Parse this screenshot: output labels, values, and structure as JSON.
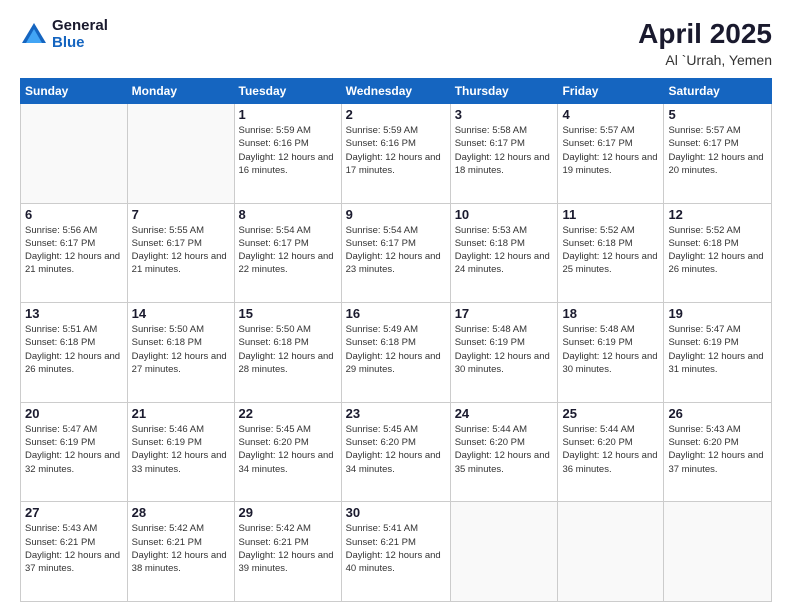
{
  "logo": {
    "general": "General",
    "blue": "Blue"
  },
  "header": {
    "month": "April 2025",
    "location": "Al `Urrah, Yemen"
  },
  "weekdays": [
    "Sunday",
    "Monday",
    "Tuesday",
    "Wednesday",
    "Thursday",
    "Friday",
    "Saturday"
  ],
  "weeks": [
    [
      {
        "day": "",
        "info": ""
      },
      {
        "day": "",
        "info": ""
      },
      {
        "day": "1",
        "info": "Sunrise: 5:59 AM\nSunset: 6:16 PM\nDaylight: 12 hours and 16 minutes."
      },
      {
        "day": "2",
        "info": "Sunrise: 5:59 AM\nSunset: 6:16 PM\nDaylight: 12 hours and 17 minutes."
      },
      {
        "day": "3",
        "info": "Sunrise: 5:58 AM\nSunset: 6:17 PM\nDaylight: 12 hours and 18 minutes."
      },
      {
        "day": "4",
        "info": "Sunrise: 5:57 AM\nSunset: 6:17 PM\nDaylight: 12 hours and 19 minutes."
      },
      {
        "day": "5",
        "info": "Sunrise: 5:57 AM\nSunset: 6:17 PM\nDaylight: 12 hours and 20 minutes."
      }
    ],
    [
      {
        "day": "6",
        "info": "Sunrise: 5:56 AM\nSunset: 6:17 PM\nDaylight: 12 hours and 21 minutes."
      },
      {
        "day": "7",
        "info": "Sunrise: 5:55 AM\nSunset: 6:17 PM\nDaylight: 12 hours and 21 minutes."
      },
      {
        "day": "8",
        "info": "Sunrise: 5:54 AM\nSunset: 6:17 PM\nDaylight: 12 hours and 22 minutes."
      },
      {
        "day": "9",
        "info": "Sunrise: 5:54 AM\nSunset: 6:17 PM\nDaylight: 12 hours and 23 minutes."
      },
      {
        "day": "10",
        "info": "Sunrise: 5:53 AM\nSunset: 6:18 PM\nDaylight: 12 hours and 24 minutes."
      },
      {
        "day": "11",
        "info": "Sunrise: 5:52 AM\nSunset: 6:18 PM\nDaylight: 12 hours and 25 minutes."
      },
      {
        "day": "12",
        "info": "Sunrise: 5:52 AM\nSunset: 6:18 PM\nDaylight: 12 hours and 26 minutes."
      }
    ],
    [
      {
        "day": "13",
        "info": "Sunrise: 5:51 AM\nSunset: 6:18 PM\nDaylight: 12 hours and 26 minutes."
      },
      {
        "day": "14",
        "info": "Sunrise: 5:50 AM\nSunset: 6:18 PM\nDaylight: 12 hours and 27 minutes."
      },
      {
        "day": "15",
        "info": "Sunrise: 5:50 AM\nSunset: 6:18 PM\nDaylight: 12 hours and 28 minutes."
      },
      {
        "day": "16",
        "info": "Sunrise: 5:49 AM\nSunset: 6:18 PM\nDaylight: 12 hours and 29 minutes."
      },
      {
        "day": "17",
        "info": "Sunrise: 5:48 AM\nSunset: 6:19 PM\nDaylight: 12 hours and 30 minutes."
      },
      {
        "day": "18",
        "info": "Sunrise: 5:48 AM\nSunset: 6:19 PM\nDaylight: 12 hours and 30 minutes."
      },
      {
        "day": "19",
        "info": "Sunrise: 5:47 AM\nSunset: 6:19 PM\nDaylight: 12 hours and 31 minutes."
      }
    ],
    [
      {
        "day": "20",
        "info": "Sunrise: 5:47 AM\nSunset: 6:19 PM\nDaylight: 12 hours and 32 minutes."
      },
      {
        "day": "21",
        "info": "Sunrise: 5:46 AM\nSunset: 6:19 PM\nDaylight: 12 hours and 33 minutes."
      },
      {
        "day": "22",
        "info": "Sunrise: 5:45 AM\nSunset: 6:20 PM\nDaylight: 12 hours and 34 minutes."
      },
      {
        "day": "23",
        "info": "Sunrise: 5:45 AM\nSunset: 6:20 PM\nDaylight: 12 hours and 34 minutes."
      },
      {
        "day": "24",
        "info": "Sunrise: 5:44 AM\nSunset: 6:20 PM\nDaylight: 12 hours and 35 minutes."
      },
      {
        "day": "25",
        "info": "Sunrise: 5:44 AM\nSunset: 6:20 PM\nDaylight: 12 hours and 36 minutes."
      },
      {
        "day": "26",
        "info": "Sunrise: 5:43 AM\nSunset: 6:20 PM\nDaylight: 12 hours and 37 minutes."
      }
    ],
    [
      {
        "day": "27",
        "info": "Sunrise: 5:43 AM\nSunset: 6:21 PM\nDaylight: 12 hours and 37 minutes."
      },
      {
        "day": "28",
        "info": "Sunrise: 5:42 AM\nSunset: 6:21 PM\nDaylight: 12 hours and 38 minutes."
      },
      {
        "day": "29",
        "info": "Sunrise: 5:42 AM\nSunset: 6:21 PM\nDaylight: 12 hours and 39 minutes."
      },
      {
        "day": "30",
        "info": "Sunrise: 5:41 AM\nSunset: 6:21 PM\nDaylight: 12 hours and 40 minutes."
      },
      {
        "day": "",
        "info": ""
      },
      {
        "day": "",
        "info": ""
      },
      {
        "day": "",
        "info": ""
      }
    ]
  ]
}
